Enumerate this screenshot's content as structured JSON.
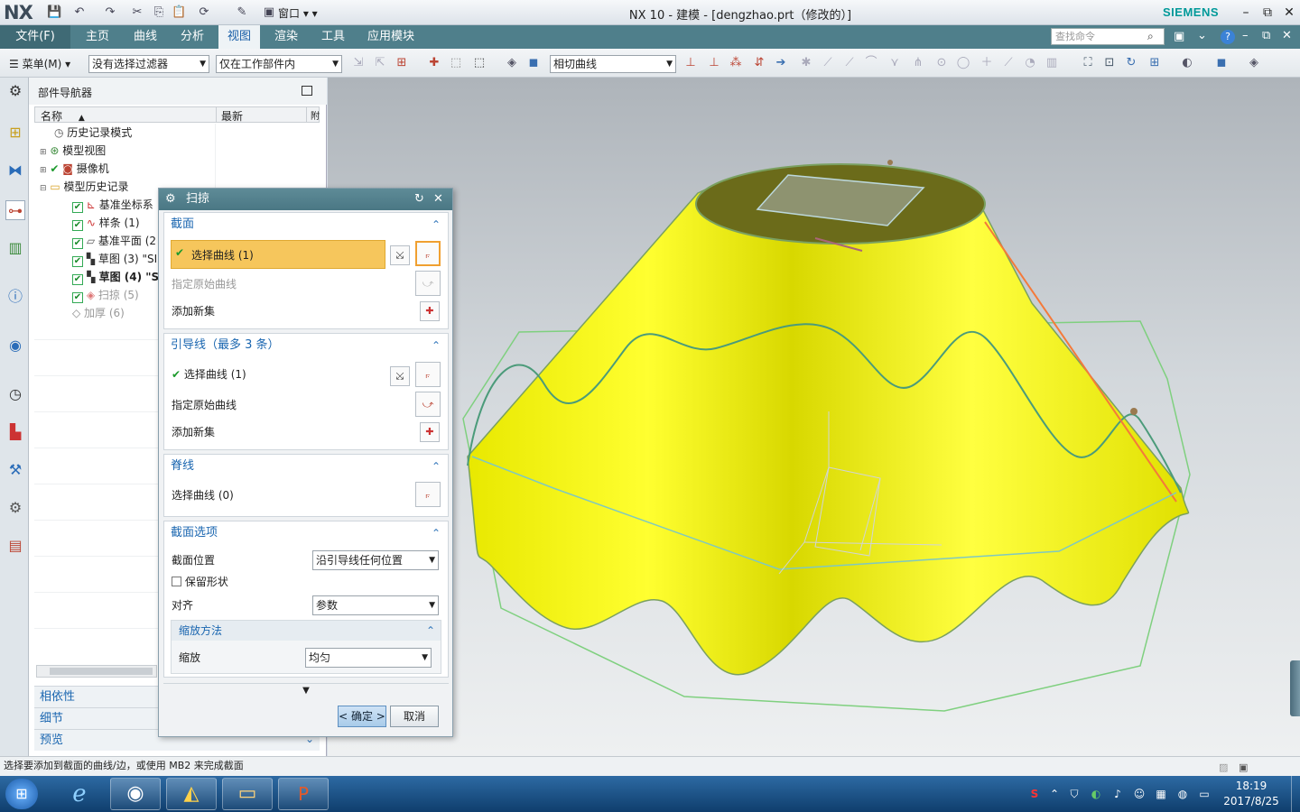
{
  "app": {
    "logo": "NX",
    "window_title": "NX 10 - 建模 - [dengzhao.prt（修改的）]",
    "brand": "SIEMENS"
  },
  "menu": {
    "file": "文件(F)",
    "tabs": [
      "主页",
      "曲线",
      "分析",
      "视图",
      "渲染",
      "工具",
      "应用模块"
    ],
    "active_tab": "视图",
    "search_placeholder": "查找命令"
  },
  "toolbar": {
    "menu_label": "菜单(M)",
    "filter": "没有选择过滤器",
    "scope": "仅在工作部件内",
    "curve_rule": "相切曲线"
  },
  "navigator": {
    "title": "部件导航器",
    "columns": [
      "名称",
      "最新",
      "附"
    ],
    "items": [
      {
        "label": "历史记录模式",
        "icon": "clock-icon"
      },
      {
        "label": "模型视图",
        "icon": "views-icon"
      },
      {
        "label": "摄像机",
        "icon": "camera-icon"
      },
      {
        "label": "模型历史记录",
        "icon": "folder-icon"
      },
      {
        "label": "基准坐标系",
        "icon": "csys-icon"
      },
      {
        "label": "样条 (1)",
        "icon": "spline-icon"
      },
      {
        "label": "基准平面 (2",
        "icon": "plane-icon"
      },
      {
        "label": "草图 (3) \"SI",
        "icon": "sketch-icon"
      },
      {
        "label": "草图 (4) \"S",
        "icon": "sketch-icon"
      },
      {
        "label": "扫掠 (5)",
        "icon": "sweep-icon"
      },
      {
        "label": "加厚 (6)",
        "icon": "thicken-icon"
      }
    ],
    "sections": [
      "相依性",
      "细节",
      "预览"
    ]
  },
  "dialog": {
    "title": "扫掠",
    "section_group": {
      "title": "截面",
      "select_curve": "选择曲线 (1)",
      "specify_origin": "指定原始曲线",
      "add_new_set": "添加新集"
    },
    "guide_group": {
      "title": "引导线（最多 3 条）",
      "select_curve": "选择曲线 (1)",
      "specify_origin": "指定原始曲线",
      "add_new_set": "添加新集"
    },
    "spine_group": {
      "title": "脊线",
      "select_curve": "选择曲线 (0)"
    },
    "options_group": {
      "title": "截面选项",
      "position_label": "截面位置",
      "position_value": "沿引导线任何位置",
      "preserve_shape": "保留形状",
      "align_label": "对齐",
      "align_value": "参数",
      "scaling_title": "缩放方法",
      "scale_label": "缩放",
      "scale_value": "均匀"
    },
    "ok": "< 确定 >",
    "cancel": "取消"
  },
  "statusbar": {
    "message": "选择要添加到截面的曲线/边，或使用 MB2 来完成截面"
  },
  "taskbar": {
    "time": "18:19",
    "date": "2017/8/25"
  },
  "colors": {
    "surface": "#f2f20a",
    "menubar": "#4f7f8b",
    "highlight": "#f6c65c"
  }
}
